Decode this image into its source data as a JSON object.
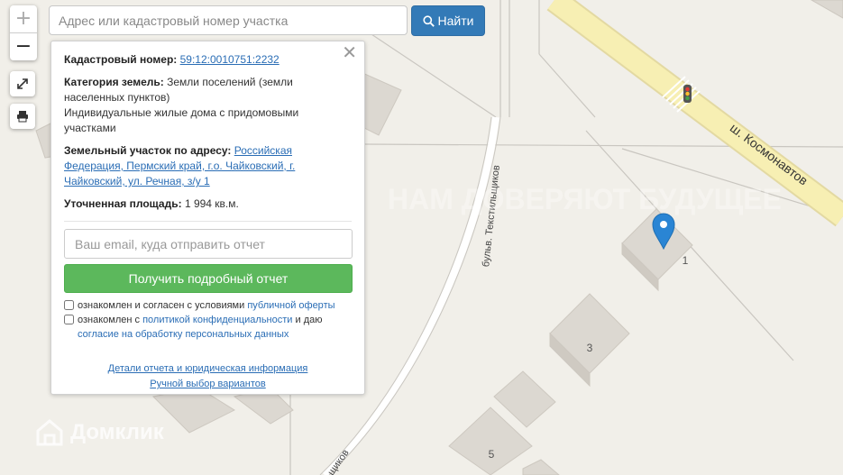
{
  "search": {
    "placeholder": "Адрес или кадастровый номер участка",
    "button_label": "Найти"
  },
  "zoom": {
    "in_label": "+",
    "out_label": "−"
  },
  "popup": {
    "cadastral_label": "Кадастровый номер:",
    "cadastral_value": "59:12:0010751:2232",
    "category_label": "Категория земель:",
    "category_value": "Земли поселений (земли населенных пунктов)",
    "usage_value": "Индивидуальные жилые дома с придомовыми участками",
    "address_label": "Земельный участок по адресу:",
    "address_value": "Российская Федерация, Пермский край, г.о. Чайковский, г. Чайковский, ул. Речная, з/у 1",
    "area_label": "Уточненная площадь:",
    "area_value": "1 994 кв.м.",
    "email_placeholder": "Ваш email, куда отправить отчет",
    "report_button": "Получить подробный отчет",
    "consent1_text": "ознакомлен и согласен с условиями",
    "consent1_link": "публичной оферты",
    "consent2_text": "ознакомлен с",
    "consent2_link": "политикой конфиденциальности",
    "consent2_mid": "и даю",
    "consent2_link2": "согласие на обработку персональных данных",
    "details_link": "Детали отчета и юридическая информация",
    "manual_link": "Ручной выбор вариантов"
  },
  "map": {
    "street_kosmonavtov": "ш. Космонавтов",
    "street_tekstilshchikov": "бульв. Текстильщиков",
    "street_bottom": "щиков",
    "house_numbers": [
      "1",
      "3",
      "5"
    ],
    "watermark_big": "НАМ ДОВЕРЯЮТ БУДУЩЕЕ",
    "brand": "Домклик"
  },
  "colors": {
    "accent_blue": "#337ab7",
    "green": "#5cb85c",
    "road_yellow": "#f7efb3",
    "marker": "#2a85d4"
  }
}
